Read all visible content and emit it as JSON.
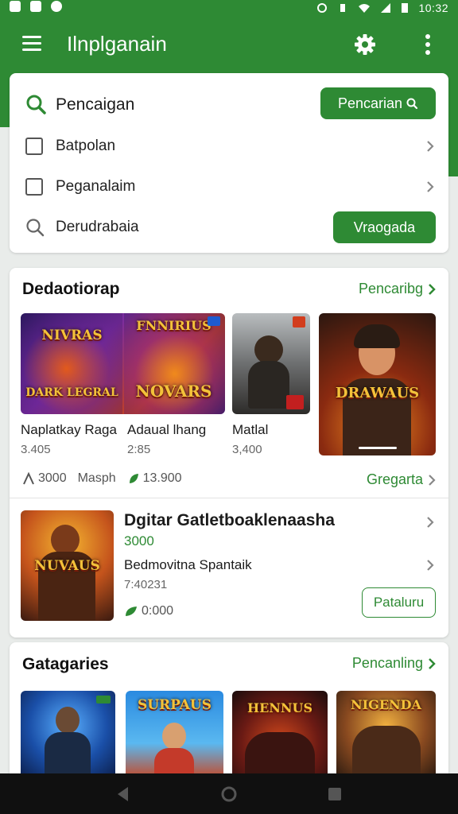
{
  "status_bar": {
    "time": "10:32"
  },
  "app_bar": {
    "title": "Ilnplganain"
  },
  "search": {
    "label": "Pencaigan",
    "button_label": "Pencarian",
    "options": [
      {
        "label": "Batpolan"
      },
      {
        "label": "Peganalaim"
      }
    ],
    "history_label": "Derudrabaia",
    "history_button": "Vraogada"
  },
  "featured": {
    "title": "Dedaotiorap",
    "link": "Pencaribg",
    "thumb_texts": [
      "NIVRAS",
      "DARK LEGRAL",
      "FNNIRIUS",
      "NOVARS",
      "DRAWAUS"
    ],
    "games": [
      {
        "title": "Naplatkay Raga",
        "meta": "3.405"
      },
      {
        "title": "Adaual lhang",
        "meta": "2:85"
      },
      {
        "title": "Matlal",
        "meta": "3,400"
      }
    ],
    "stats": {
      "first": "3000",
      "second": "Masph",
      "third": "13.900"
    },
    "stats_link": "Gregarta",
    "highlight": {
      "thumb_text": "NUVAUS",
      "title": "Dgitar Gatletboaklenaasha",
      "price": "3000",
      "subtitle": "Bedmovitna Spantaik",
      "meta": "7:40231",
      "rating": "0:000",
      "button_label": "Pataluru"
    }
  },
  "categories": {
    "title": "Gatagaries",
    "link": "Pencanling",
    "thumb_texts": [
      "SURPAUS",
      "HENNUS",
      "NIGENDA"
    ]
  }
}
